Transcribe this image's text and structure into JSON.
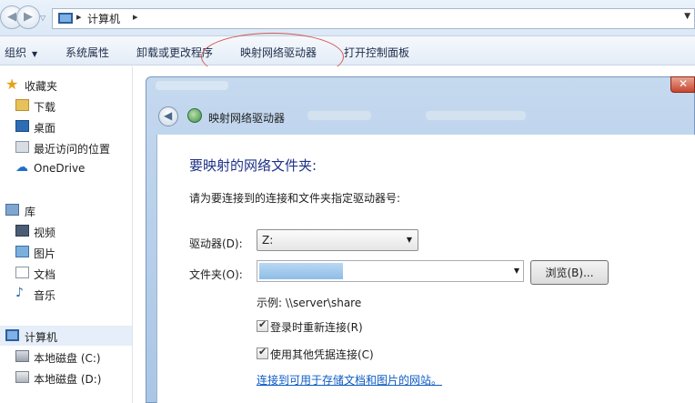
{
  "address_bar": {
    "location": "计算机"
  },
  "toolbar": {
    "organize": "组织",
    "system_properties": "系统属性",
    "uninstall": "卸载或更改程序",
    "map_drive": "映射网络驱动器",
    "control_panel": "打开控制面板"
  },
  "sidebar": {
    "favorites": "收藏夹",
    "downloads": "下载",
    "desktop": "桌面",
    "recent": "最近访问的位置",
    "onedrive": "OneDrive",
    "libraries": "库",
    "videos": "视频",
    "pictures": "图片",
    "documents": "文档",
    "music": "音乐",
    "computer": "计算机",
    "drive_c": "本地磁盘 (C:)",
    "drive_d": "本地磁盘 (D:)"
  },
  "dialog": {
    "window_title": "映射网络驱动器",
    "heading": "要映射的网络文件夹:",
    "instruction": "请为要连接到的连接和文件夹指定驱动器号:",
    "drive_label": "驱动器(D):",
    "drive_value": "Z:",
    "folder_label": "文件夹(O):",
    "browse_label": "浏览(B)...",
    "example": "示例: \\\\server\\share",
    "reconnect_label": "登录时重新连接(R)",
    "reconnect_checked": true,
    "credentials_label": "使用其他凭据连接(C)",
    "credentials_checked": true,
    "link_text": "连接到可用于存储文档和图片的网站。"
  }
}
